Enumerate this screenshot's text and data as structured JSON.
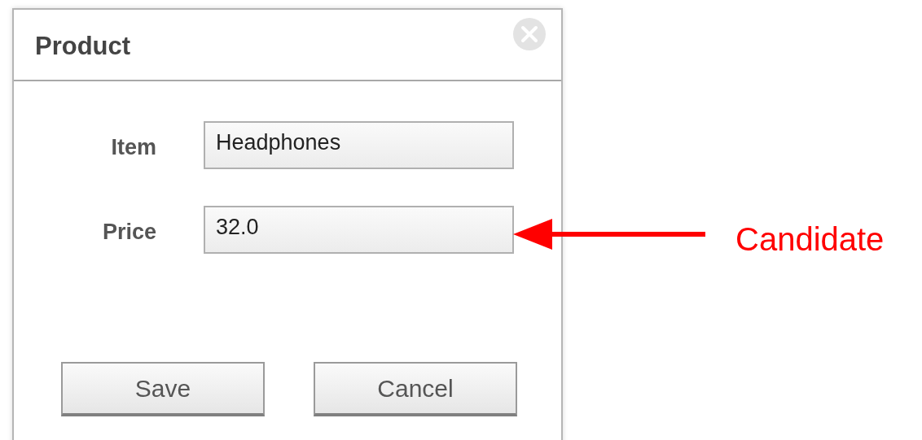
{
  "dialog": {
    "title": "Product",
    "fields": [
      {
        "label": "Item",
        "value": "Headphones"
      },
      {
        "label": "Price",
        "value": "32.0"
      }
    ],
    "buttons": [
      "Save",
      "Cancel"
    ]
  },
  "annotation": {
    "label": "Candidate"
  }
}
